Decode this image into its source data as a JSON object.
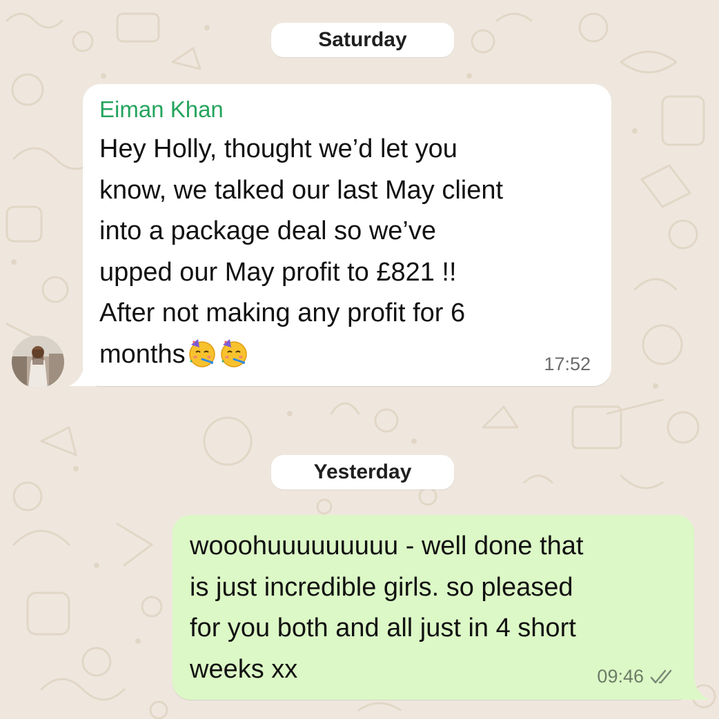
{
  "dates": {
    "first": "Saturday",
    "second": "Yesterday"
  },
  "incoming": {
    "sender": "Eiman Khan",
    "lines": [
      "Hey Holly, thought we’d let you",
      "know, we talked our last May client",
      "into a package deal so we’ve",
      "upped our May profit to £821 !!",
      "After not making any profit for 6",
      "months"
    ],
    "emoji": [
      "partying-face",
      "partying-face"
    ],
    "time": "17:52"
  },
  "outgoing": {
    "lines": [
      "wooohuuuuuuuuu - well done that",
      "is just incredible girls. so pleased",
      "for you both and all just in 4 short",
      "weeks xx"
    ],
    "time": "09:46",
    "status_icon": "double-check-icon"
  },
  "colors": {
    "wallpaper": "#efe7de",
    "incoming_bubble": "#ffffff",
    "outgoing_bubble": "#dcf8c6",
    "sender_name": "#25a45e",
    "read_ticks": "#7a8a77"
  }
}
